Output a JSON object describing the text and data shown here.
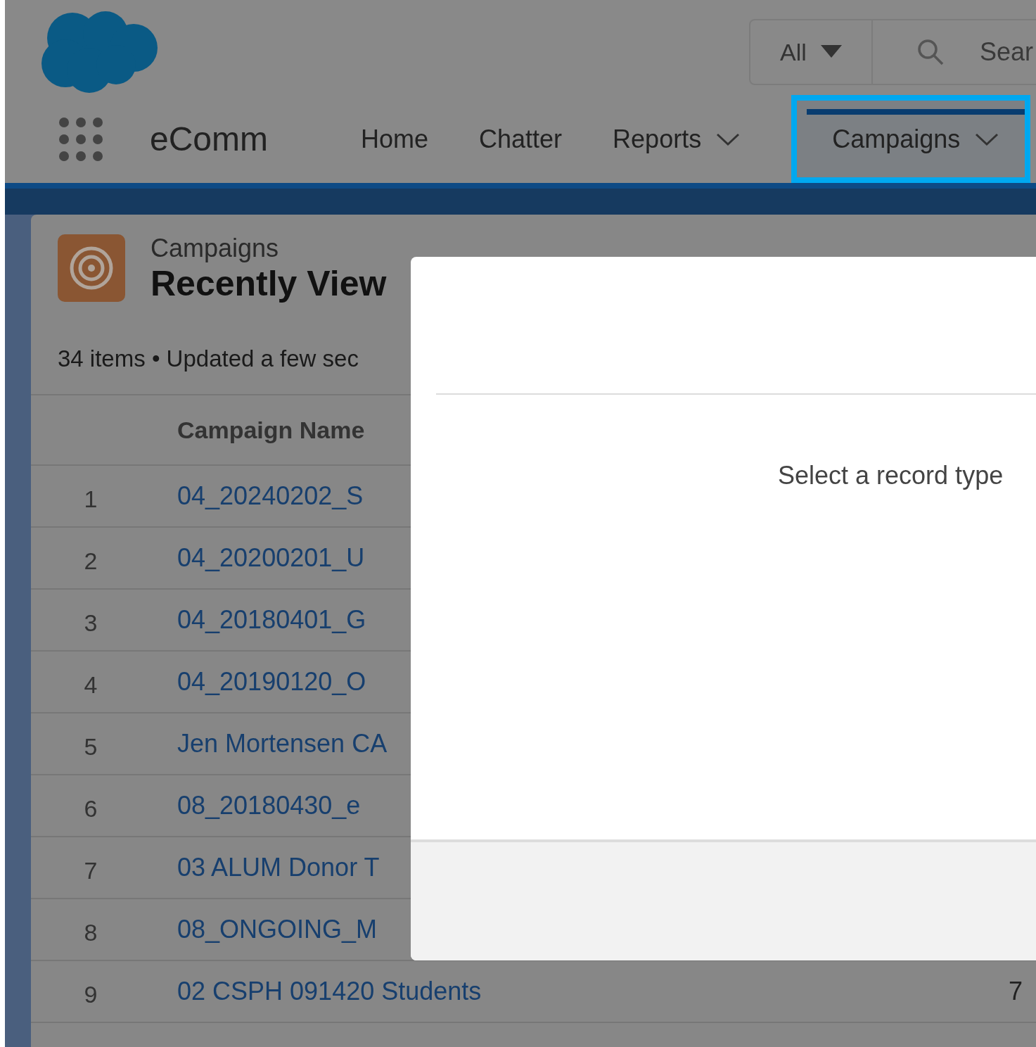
{
  "header": {
    "search_scope": "All",
    "search_placeholder": "Sear"
  },
  "app": {
    "name": "eComm"
  },
  "nav_tabs": [
    {
      "label": "Home",
      "selected": false,
      "has_menu": false
    },
    {
      "label": "Chatter",
      "selected": false,
      "has_menu": false
    },
    {
      "label": "Reports",
      "selected": false,
      "has_menu": true
    },
    {
      "label": "Campaigns",
      "selected": true,
      "has_menu": true
    }
  ],
  "list_view": {
    "object": "Campaigns",
    "title": "Recently View",
    "summary": "34 items • Updated a few sec"
  },
  "table": {
    "columns": [
      "Campaign Name"
    ],
    "rows": [
      {
        "number": "1",
        "name": "04_20240202_S"
      },
      {
        "number": "2",
        "name": "04_20200201_U"
      },
      {
        "number": "3",
        "name": "04_20180401_G"
      },
      {
        "number": "4",
        "name": "04_20190120_O"
      },
      {
        "number": "5",
        "name": "Jen Mortensen CA"
      },
      {
        "number": "6",
        "name": "08_20180430_e"
      },
      {
        "number": "7",
        "name": "03 ALUM Donor T"
      },
      {
        "number": "8",
        "name": "08_ONGOING_M"
      },
      {
        "number": "9",
        "name": "02 CSPH 091420 Students",
        "column_2": "7"
      }
    ]
  },
  "modal": {
    "prompt": "Select a record type"
  }
}
